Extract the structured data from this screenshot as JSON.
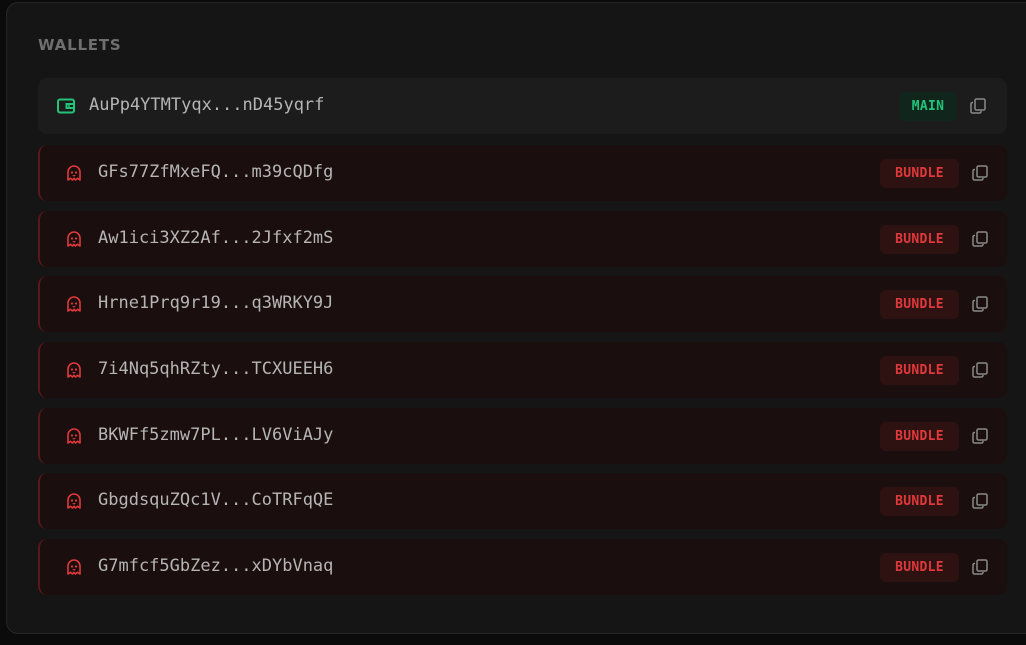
{
  "panel": {
    "title": "WALLETS"
  },
  "wallets": [
    {
      "address": "AuPp4YTMTyqx...nD45yqrf",
      "badge": "MAIN",
      "type": "main"
    },
    {
      "address": "GFs77ZfMxeFQ...m39cQDfg",
      "badge": "BUNDLE",
      "type": "bundle"
    },
    {
      "address": "Aw1ici3XZ2Af...2Jfxf2mS",
      "badge": "BUNDLE",
      "type": "bundle"
    },
    {
      "address": "Hrne1Prq9r19...q3WRKY9J",
      "badge": "BUNDLE",
      "type": "bundle"
    },
    {
      "address": "7i4Nq5qhRZty...TCXUEEH6",
      "badge": "BUNDLE",
      "type": "bundle"
    },
    {
      "address": "BKWFf5zmw7PL...LV6ViAJy",
      "badge": "BUNDLE",
      "type": "bundle"
    },
    {
      "address": "GbgdsquZQc1V...CoTRFqQE",
      "badge": "BUNDLE",
      "type": "bundle"
    },
    {
      "address": "G7mfcf5GbZez...xDYbVnaq",
      "badge": "BUNDLE",
      "type": "bundle"
    }
  ],
  "icons": {
    "main": "wallet-icon",
    "bundle": "ghost-icon",
    "copy": "copy-icon"
  },
  "colors": {
    "main_accent": "#22c47a",
    "bundle_accent": "#e0393b"
  }
}
